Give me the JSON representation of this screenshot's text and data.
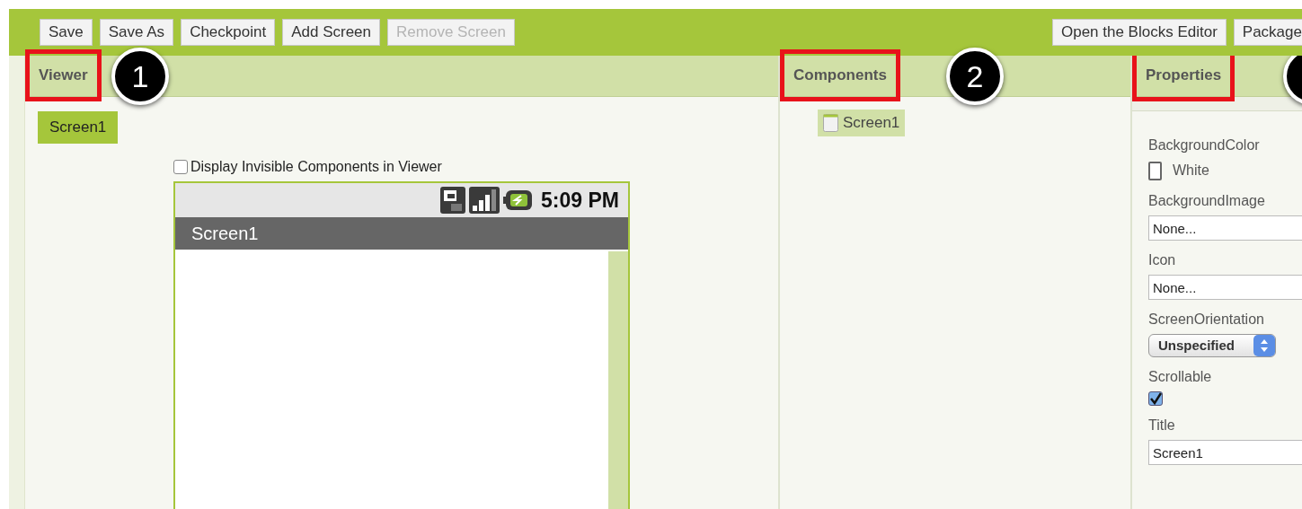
{
  "toolbar": {
    "left_buttons": [
      {
        "label": "Save",
        "disabled": false
      },
      {
        "label": "Save As",
        "disabled": false
      },
      {
        "label": "Checkpoint",
        "disabled": false
      },
      {
        "label": "Add Screen",
        "disabled": false
      },
      {
        "label": "Remove Screen",
        "disabled": true
      }
    ],
    "right_buttons": [
      {
        "label": "Open the Blocks Editor",
        "disabled": false
      },
      {
        "label": "Package",
        "disabled": false
      }
    ]
  },
  "viewer": {
    "title": "Viewer",
    "callout": "1",
    "screen_tabs": [
      {
        "label": "Screen1",
        "selected": true
      }
    ],
    "invisible_toggle": {
      "label": "Display Invisible Components in Viewer",
      "checked": false
    },
    "phone": {
      "time": "5:09 PM",
      "title": "Screen1"
    }
  },
  "components": {
    "title": "Components",
    "callout": "2",
    "tree": [
      {
        "label": "Screen1",
        "selected": true
      }
    ]
  },
  "properties": {
    "title": "Properties",
    "items": [
      {
        "kind": "color",
        "label": "BackgroundColor",
        "value": "White"
      },
      {
        "kind": "field",
        "label": "BackgroundImage",
        "value": "None..."
      },
      {
        "kind": "field",
        "label": "Icon",
        "value": "None..."
      },
      {
        "kind": "select",
        "label": "ScreenOrientation",
        "value": "Unspecified"
      },
      {
        "kind": "checkbox",
        "label": "Scrollable",
        "checked": true
      },
      {
        "kind": "field",
        "label": "Title",
        "value": "Screen1"
      }
    ]
  }
}
